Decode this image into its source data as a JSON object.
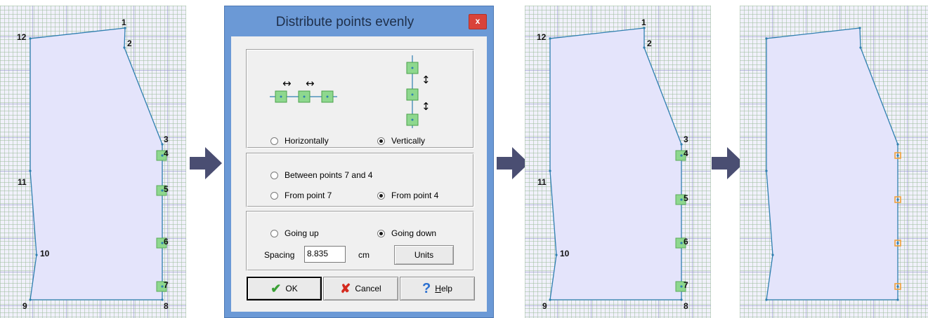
{
  "dialog": {
    "title": "Distribute points evenly",
    "close_label": "x",
    "orientation": {
      "horizontally_label": "Horizontally",
      "vertically_label": "Vertically",
      "selected": "vertically"
    },
    "range": {
      "between_label": "Between points 7 and 4",
      "from_7_label": "From point 7",
      "from_4_label": "From point 4",
      "selected": "from_4"
    },
    "direction": {
      "up_label": "Going up",
      "down_label": "Going down",
      "selected": "down"
    },
    "spacing_label": "Spacing",
    "spacing_value": "8.835",
    "spacing_unit": "cm",
    "units_button": "Units",
    "ok_button": "OK",
    "cancel_button": "Cancel",
    "help_button_prefix": "H",
    "help_button_rest": "elp"
  },
  "panel1": {
    "labels": {
      "p1": "1",
      "p2": "2",
      "p3": "3",
      "p4": "4",
      "p5": "5",
      "p6": "6",
      "p7": "7",
      "p8": "8",
      "p9": "9",
      "p10": "10",
      "p11": "11",
      "p12": "12"
    }
  },
  "panel3": {
    "labels": {
      "p1": "1",
      "p2": "2",
      "p3": "3",
      "p4": "4",
      "p5": "5",
      "p6": "6",
      "p7": "7",
      "p8": "8",
      "p9": "9",
      "p10": "10",
      "p11": "11",
      "p12": "12"
    }
  },
  "colors": {
    "arrow": "#4a4e72",
    "shape_fill": "#e4e4fb",
    "shape_stroke": "#2f7fb0",
    "selected_point": "#8ed88e",
    "highlight_point": "#f2a23c"
  }
}
